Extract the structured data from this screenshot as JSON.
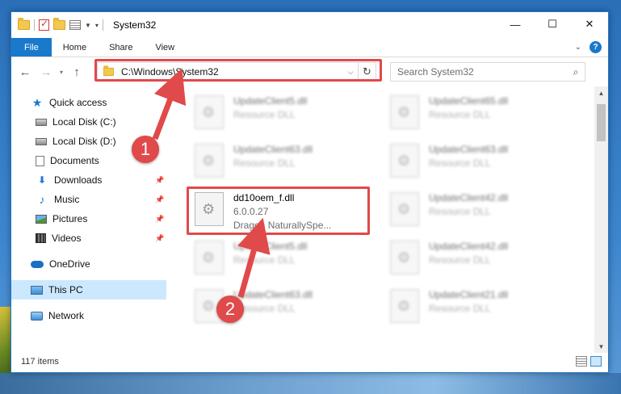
{
  "window": {
    "title": "System32",
    "controls": {
      "minimize": "—",
      "maximize": "☐",
      "close": "✕"
    }
  },
  "quick_access_toolbar": [
    "folder-icon",
    "properties-check-icon",
    "new-folder-icon",
    "properties-icon",
    "customize-caret"
  ],
  "ribbon": {
    "tabs": [
      {
        "label": "File",
        "active": true
      },
      {
        "label": "Home"
      },
      {
        "label": "Share"
      },
      {
        "label": "View"
      }
    ]
  },
  "navigation": {
    "back": "←",
    "forward": "→",
    "up": "↑",
    "address": "C:\\Windows\\System32",
    "search_placeholder": "Search System32"
  },
  "sidebar": {
    "items": [
      {
        "label": "Quick access",
        "icon": "star-icon"
      },
      {
        "label": "Local Disk (C:)",
        "icon": "disk-icon"
      },
      {
        "label": "Local Disk (D:)",
        "icon": "disk-icon"
      },
      {
        "label": "Documents",
        "icon": "documents-icon"
      },
      {
        "label": "Downloads",
        "icon": "downloads-icon",
        "pinned": true
      },
      {
        "label": "Music",
        "icon": "music-icon",
        "pinned": true
      },
      {
        "label": "Pictures",
        "icon": "pictures-icon",
        "pinned": true
      },
      {
        "label": "Videos",
        "icon": "videos-icon",
        "pinned": true
      },
      {
        "label": "OneDrive",
        "icon": "onedrive-icon"
      },
      {
        "label": "This PC",
        "icon": "pc-icon",
        "selected": true
      },
      {
        "label": "Network",
        "icon": "network-icon"
      }
    ]
  },
  "files": [
    {
      "name": "UpdateClient5.dll",
      "type": "Resource DLL"
    },
    {
      "name": "UpdateClient65.dll",
      "type": "Resource DLL"
    },
    {
      "name": "UpdateClient63.dll",
      "type": "Resource DLL"
    },
    {
      "name": "UpdateClient63.dll",
      "type": "Resource DLL"
    },
    {
      "name": "dd10oem_f.dll",
      "version": "6.0.0.27",
      "type": "Dragon NaturallySpe...",
      "highlighted": true
    },
    {
      "name": "UpdateClient42.dll",
      "type": "Resource DLL"
    },
    {
      "name": "UpdateClient5.dll",
      "type": "Resource DLL"
    },
    {
      "name": "UpdateClient42.dll",
      "type": "Resource DLL"
    },
    {
      "name": "UpdateClient63.dll",
      "type": "Resource DLL"
    },
    {
      "name": "UpdateClient21.dll",
      "type": "Resource DLL"
    }
  ],
  "status": {
    "item_count": "117 items"
  },
  "annotations": {
    "step1": "1",
    "step2": "2",
    "color": "#e04a4a"
  }
}
